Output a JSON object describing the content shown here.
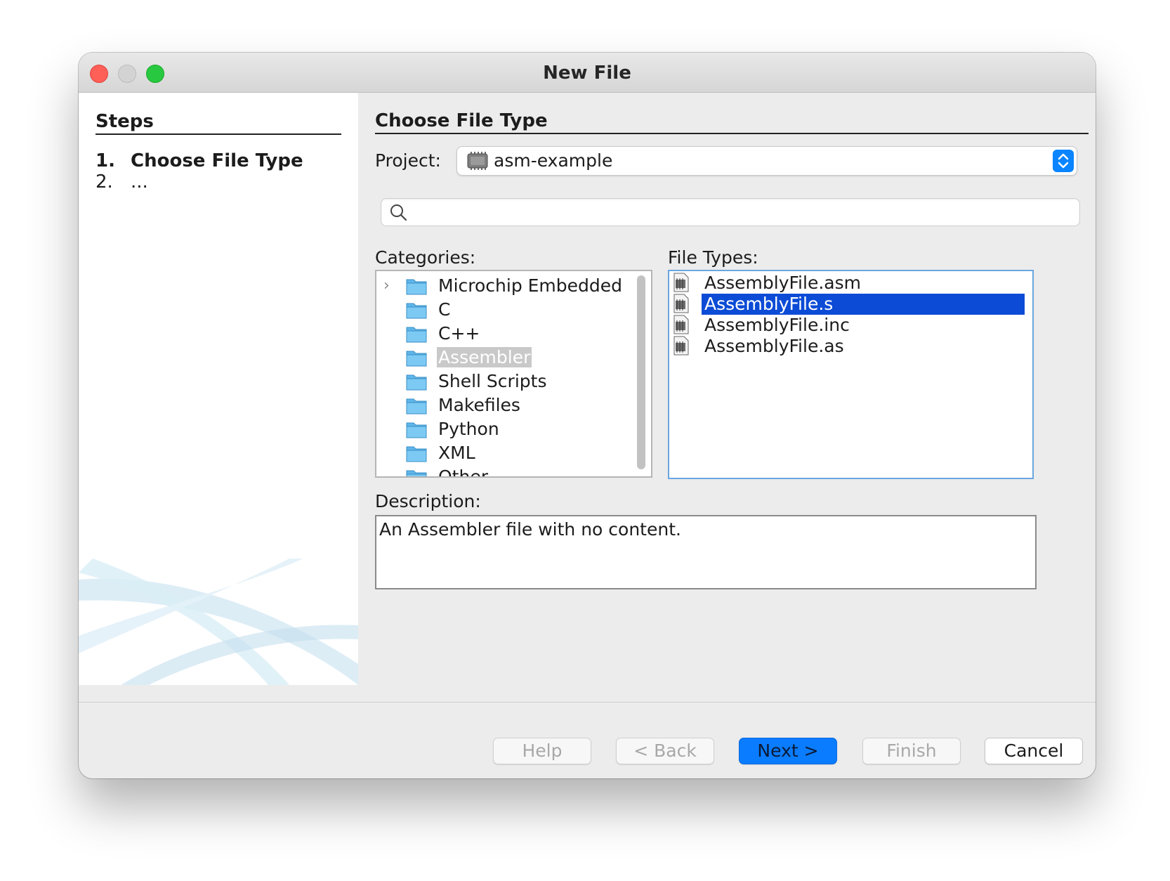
{
  "window": {
    "title": "New File"
  },
  "steps": {
    "heading": "Steps",
    "items": [
      {
        "num": "1.",
        "label": "Choose File Type"
      },
      {
        "num": "2.",
        "label": "..."
      }
    ]
  },
  "main": {
    "heading": "Choose File Type",
    "project_label": "Project:",
    "project_value": "asm-example",
    "search": {
      "placeholder": ""
    },
    "categories_label": "Categories:",
    "categories": [
      "Microchip Embedded",
      "C",
      "C++",
      "Assembler",
      "Shell Scripts",
      "Makefiles",
      "Python",
      "XML",
      "Other"
    ],
    "selected_category": "Assembler",
    "file_types_label": "File Types:",
    "file_types": [
      "AssemblyFile.asm",
      "AssemblyFile.s",
      "AssemblyFile.inc",
      "AssemblyFile.as"
    ],
    "selected_file_type": "AssemblyFile.s",
    "description_label": "Description:",
    "description": "An Assembler file with no content."
  },
  "buttons": {
    "help": "Help",
    "back": "< Back",
    "next": "Next >",
    "finish": "Finish",
    "cancel": "Cancel"
  },
  "colors": {
    "accent": "#0a7cff",
    "selection": "#0b4bd6",
    "close": "#fe5f57",
    "zoom": "#28c840"
  }
}
